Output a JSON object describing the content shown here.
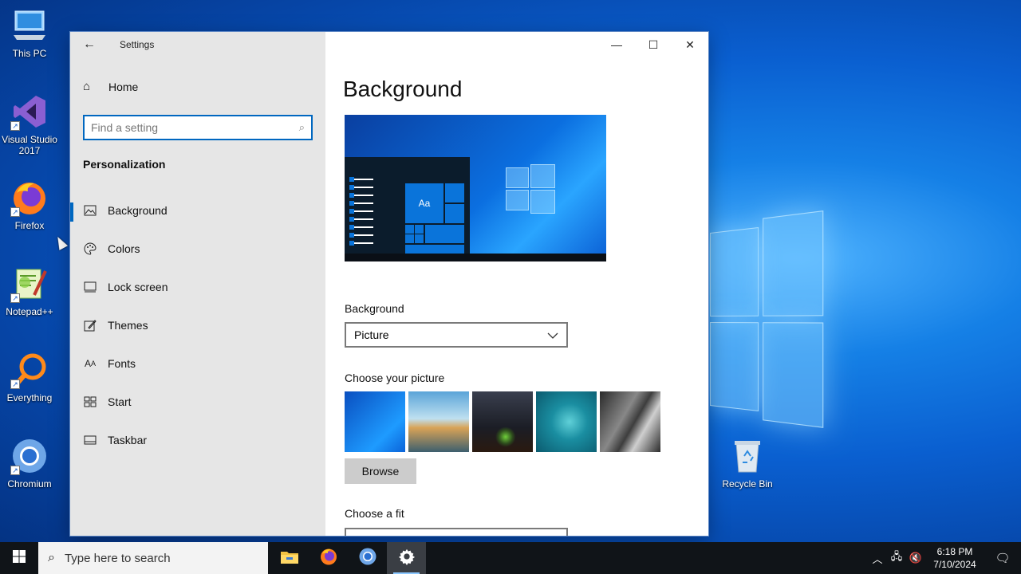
{
  "desktop": {
    "icons": [
      {
        "label": "This PC",
        "icon": "computer-icon"
      },
      {
        "label": "Visual Studio 2017",
        "icon": "visual-studio-icon"
      },
      {
        "label": "Firefox",
        "icon": "firefox-icon"
      },
      {
        "label": "Notepad++",
        "icon": "notepadpp-icon"
      },
      {
        "label": "Everything",
        "icon": "magnifier-icon"
      },
      {
        "label": "Chromium",
        "icon": "chromium-icon"
      },
      {
        "label": "Recycle Bin",
        "icon": "recycle-bin-icon"
      }
    ]
  },
  "window": {
    "title": "Settings",
    "home_label": "Home",
    "search_placeholder": "Find a setting",
    "section": "Personalization",
    "nav": [
      {
        "label": "Background",
        "icon": "picture-icon",
        "active": true
      },
      {
        "label": "Colors",
        "icon": "palette-icon",
        "active": false
      },
      {
        "label": "Lock screen",
        "icon": "lock-screen-icon",
        "active": false
      },
      {
        "label": "Themes",
        "icon": "themes-icon",
        "active": false
      },
      {
        "label": "Fonts",
        "icon": "fonts-icon",
        "active": false
      },
      {
        "label": "Start",
        "icon": "start-icon",
        "active": false
      },
      {
        "label": "Taskbar",
        "icon": "taskbar-icon",
        "active": false
      }
    ],
    "content": {
      "page_title": "Background",
      "preview_tile_text": "Aa",
      "background_label": "Background",
      "background_value": "Picture",
      "choose_picture_label": "Choose your picture",
      "browse_label": "Browse",
      "choose_fit_label": "Choose a fit"
    }
  },
  "taskbar": {
    "search_placeholder": "Type here to search",
    "time": "6:18 PM",
    "date": "7/10/2024",
    "apps": [
      "file-explorer-icon",
      "firefox-icon",
      "chromium-icon",
      "settings-gear-icon"
    ]
  },
  "colors": {
    "accent": "#0067c0",
    "sidebar_bg": "#e6e6e6",
    "taskbar_bg": "#101418"
  }
}
